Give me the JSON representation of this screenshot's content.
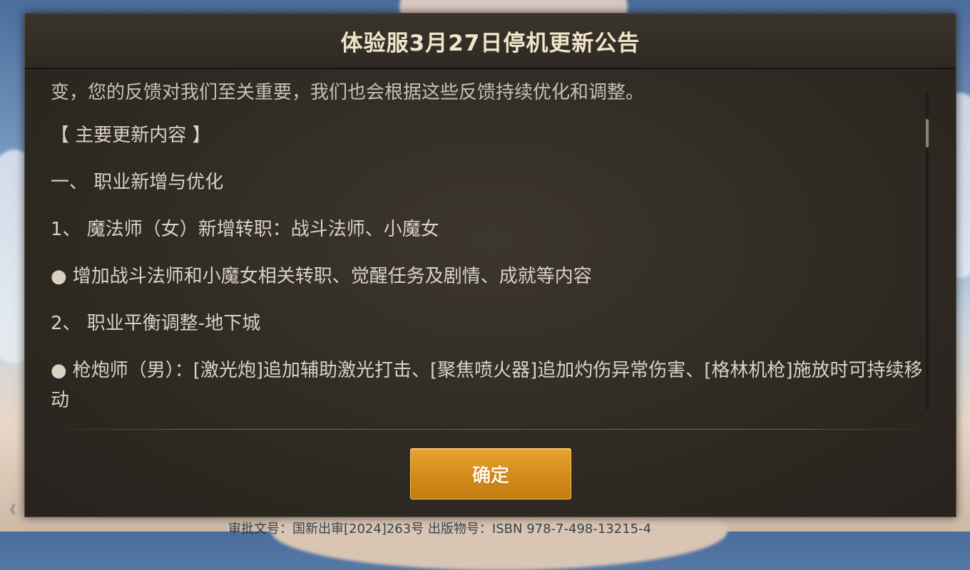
{
  "dialog": {
    "title": "体验服3月27日停机更新公告",
    "confirm_label": "确定"
  },
  "notice": {
    "cut_line": "变，您的反馈对我们至关重要，我们也会根据这些反馈持续优化和调整。",
    "section_header": "【 主要更新内容 】",
    "heading_1": "一、 职业新增与优化",
    "item_1": "1、 魔法师（女）新增转职：战斗法师、小魔女",
    "bullet_1": "增加战斗法师和小魔女相关转职、觉醒任务及剧情、成就等内容",
    "item_2": "2、 职业平衡调整-地下城",
    "bullet_2": "枪炮师（男）：[激光炮]追加辅助激光打击、[聚焦喷火器]追加灼伤异常伤害、[格林机枪]施放时可持续移动",
    "bullet_glyph": "●"
  },
  "background": {
    "footer_text": "审批文号：国新出审[2024]263号 出版物号：ISBN 978-7-498-13215-4",
    "left_mark": "《"
  },
  "colors": {
    "dialog_bg": "#302a24",
    "title_text": "#f1e4c8",
    "body_text": "#d9d2c3",
    "button_bg": "#d38a18",
    "button_text": "#fff6e4"
  }
}
